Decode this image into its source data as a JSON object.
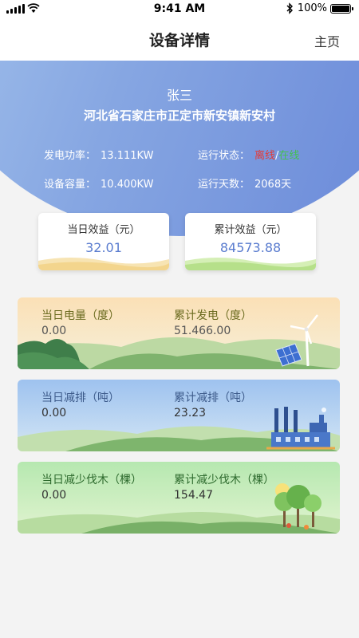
{
  "status_bar": {
    "time": "9:41 AM",
    "battery": "100%"
  },
  "nav": {
    "title": "设备详情",
    "home_label": "主页"
  },
  "device": {
    "owner_name": "张三",
    "address": "河北省石家庄市正定市新安镇新安村",
    "power_label": "发电功率：",
    "power_value": "13.111KW",
    "run_status_label": "运行状态：",
    "status_offline": "离线",
    "status_sep": "/",
    "status_online": "在线",
    "capacity_label": "设备容量：",
    "capacity_value": "10.400KW",
    "run_days_label": "运行天数：",
    "run_days_value": "2068天"
  },
  "benefits": {
    "today": {
      "label": "当日效益（元）",
      "value": "32.01"
    },
    "total": {
      "label": "累计效益（元）",
      "value": "84573.88"
    }
  },
  "stats": [
    {
      "left_label": "当日电量（度）",
      "left_value": "0.00",
      "right_label": "累计发电（度）",
      "right_value": "51.466.00"
    },
    {
      "left_label": "当日减排（吨）",
      "left_value": "0.00",
      "right_label": "累计减排（吨）",
      "right_value": "23.23"
    },
    {
      "left_label": "当日减少伐木（棵）",
      "left_value": "0.00",
      "right_label": "累计减少伐木（棵）",
      "right_value": "154.47"
    }
  ],
  "colors": {
    "hero_gradient": [
      "#a9c8ee",
      "#6786d8"
    ],
    "value_blue": "#5a7ccf",
    "offline_red": "#e53935",
    "online_green": "#43c14f"
  }
}
